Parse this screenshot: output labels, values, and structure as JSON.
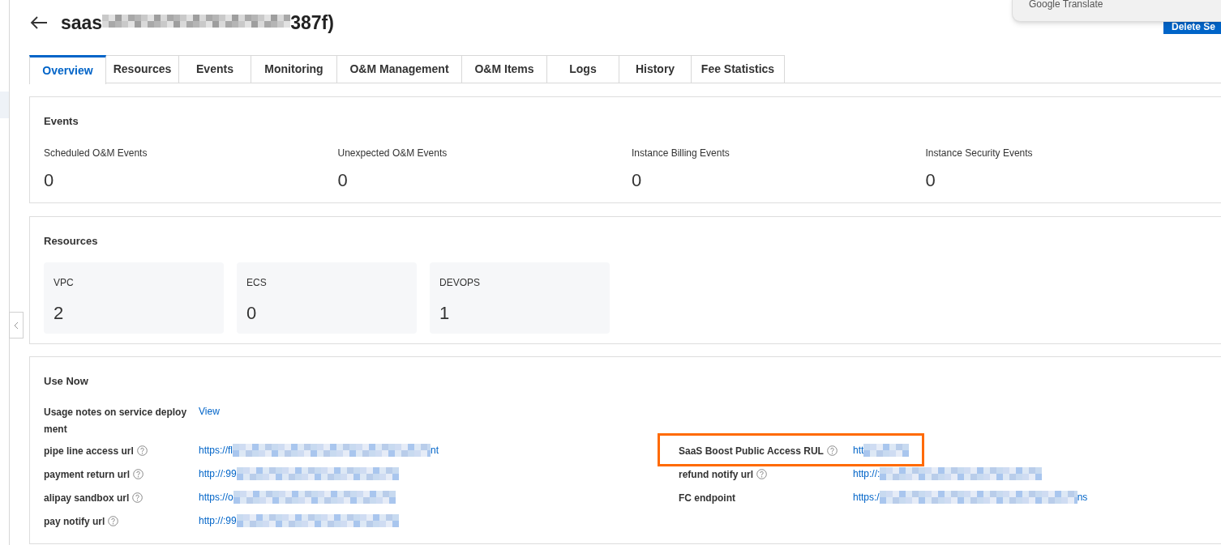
{
  "header": {
    "title_start": "saas",
    "title_end": "387f)"
  },
  "translate_popup": {
    "label": "Google Translate"
  },
  "delete_button": {
    "label": "Delete Se"
  },
  "tabs": [
    {
      "label": "Overview",
      "selected": true
    },
    {
      "label": "Resources",
      "selected": false
    },
    {
      "label": "Events",
      "selected": false
    },
    {
      "label": "Monitoring",
      "selected": false
    },
    {
      "label": "O&M Management",
      "selected": false
    },
    {
      "label": "O&M Items",
      "selected": false
    },
    {
      "label": "Logs",
      "selected": false
    },
    {
      "label": "History",
      "selected": false
    },
    {
      "label": "Fee Statistics",
      "selected": false
    }
  ],
  "events": {
    "title": "Events",
    "items": [
      {
        "label": "Scheduled O&M Events",
        "value": "0"
      },
      {
        "label": "Unexpected O&M Events",
        "value": "0"
      },
      {
        "label": "Instance Billing Events",
        "value": "0"
      },
      {
        "label": "Instance Security Events",
        "value": "0"
      }
    ]
  },
  "resources": {
    "title": "Resources",
    "items": [
      {
        "label": "VPC",
        "value": "2"
      },
      {
        "label": "ECS",
        "value": "0"
      },
      {
        "label": "DEVOPS",
        "value": "1"
      }
    ]
  },
  "use_now": {
    "title": "Use Now",
    "left": [
      {
        "label": "Usage notes on service deployment",
        "help": false,
        "value_start": "View",
        "redacted": false,
        "highlighted": false
      },
      {
        "label": "pipe line access url",
        "help": true,
        "value_start": "https://fl",
        "value_end": "nt",
        "redacted": true,
        "highlighted": false
      },
      {
        "label": "payment return url",
        "help": true,
        "value_start": "http://:99",
        "redacted": true,
        "highlighted": false
      },
      {
        "label": "alipay sandbox url",
        "help": true,
        "value_start": "https://o",
        "redacted": true,
        "highlighted": false
      },
      {
        "label": "pay notify url",
        "help": true,
        "value_start": "http://:99",
        "redacted": true,
        "highlighted": false
      }
    ],
    "right": [
      {
        "label": "SaaS Boost Public Access RUL",
        "help": true,
        "value_start": "htt",
        "redacted": true,
        "highlighted": true
      },
      {
        "label": "refund notify url",
        "help": true,
        "value_start": "http://:",
        "redacted": true,
        "highlighted": false
      },
      {
        "label": "FC endpoint",
        "help": false,
        "value_start": "https:/",
        "value_end": "ns",
        "redacted": true,
        "highlighted": false
      }
    ]
  }
}
